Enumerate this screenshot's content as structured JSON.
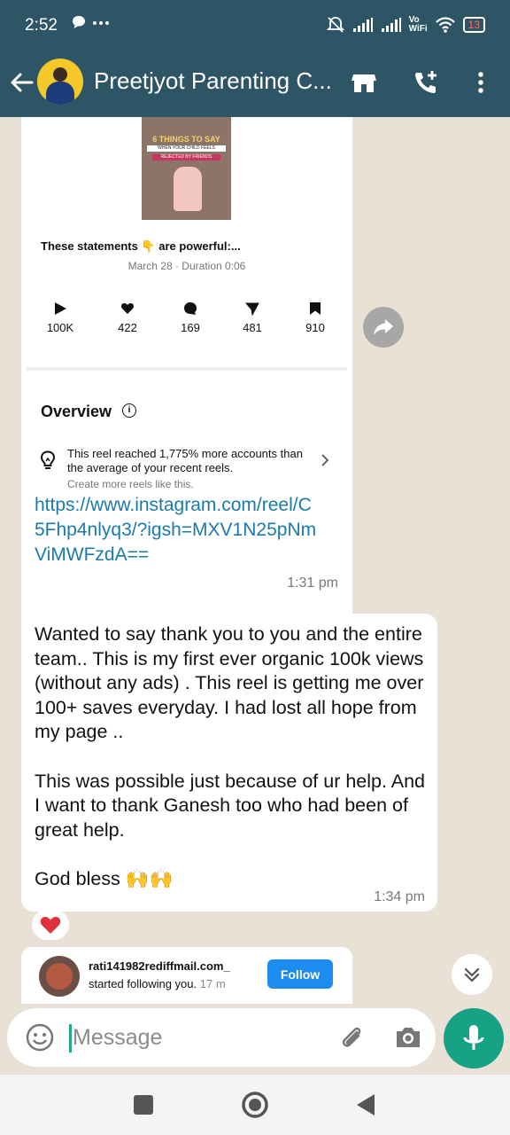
{
  "status_bar": {
    "time": "2:52",
    "left_icons": [
      "chat-bubble-icon",
      "more-dots-icon"
    ],
    "right_icons": [
      "mute-icon",
      "signal-icon",
      "signal-icon",
      "vowifi-icon",
      "wifi-icon"
    ],
    "vowifi_label": "Vo\nWiFi",
    "battery_level": "13",
    "colors": {
      "bar": "#2e5566",
      "battery_low": "#ff6b6b"
    }
  },
  "app_bar": {
    "chat_title": "Preetjyot Parenting C...",
    "icons": [
      "back-arrow-icon",
      "store-icon",
      "add-call-icon",
      "more-vertical-icon"
    ]
  },
  "reel_card": {
    "thumbnail": {
      "line1": "6 THINGS TO SAY",
      "line2": "WHEN YOUR CHILD FEELS",
      "line3": "REJECTED BY FRIENDS"
    },
    "caption": "These statements 👇 are powerful:...",
    "date_duration": "March 28 · Duration 0:06",
    "stats": [
      {
        "icon": "play-icon",
        "value": "100K"
      },
      {
        "icon": "heart-icon",
        "value": "422"
      },
      {
        "icon": "comment-icon",
        "value": "169"
      },
      {
        "icon": "send-icon",
        "value": "481"
      },
      {
        "icon": "bookmark-icon",
        "value": "910"
      }
    ],
    "overview_title": "Overview",
    "insight_main": "This reel reached 1,775% more accounts than the average of your recent reels.",
    "insight_sub": "Create more reels like this.",
    "link": "https://www.instagram.com/reel/C5Fhp4nlyq3/?igsh=MXV1N25pNmViMWFzdA==",
    "time": "1:31 pm"
  },
  "message2": {
    "text": "Wanted to say thank you to you and the entire team.. This is my first ever organic 100k views (without any ads) . This reel is getting me over 100+ saves everyday. I had lost all hope from my page ..\n\nThis was possible just because of ur help. And I want to thank Ganesh too who had been of great help.\n\nGod bless 🙌🙌",
    "time": "1:34 pm",
    "reaction": "❤️"
  },
  "notification": {
    "username": "rati141982rediffmail.com_",
    "action": "started following you.",
    "time": "17 m",
    "follow_label": "Follow"
  },
  "composer": {
    "placeholder": "Message",
    "icons": [
      "emoji-icon",
      "attach-icon",
      "camera-icon",
      "mic-icon"
    ]
  },
  "nav_bar": {
    "icons": [
      "recents-square-icon",
      "home-circle-icon",
      "back-triangle-icon"
    ]
  },
  "colors": {
    "header": "#2e5566",
    "chat_bg": "#e9e1d6",
    "link": "#1a7aaa",
    "accent_green": "#17a185",
    "follow_blue": "#1c8cf0"
  }
}
